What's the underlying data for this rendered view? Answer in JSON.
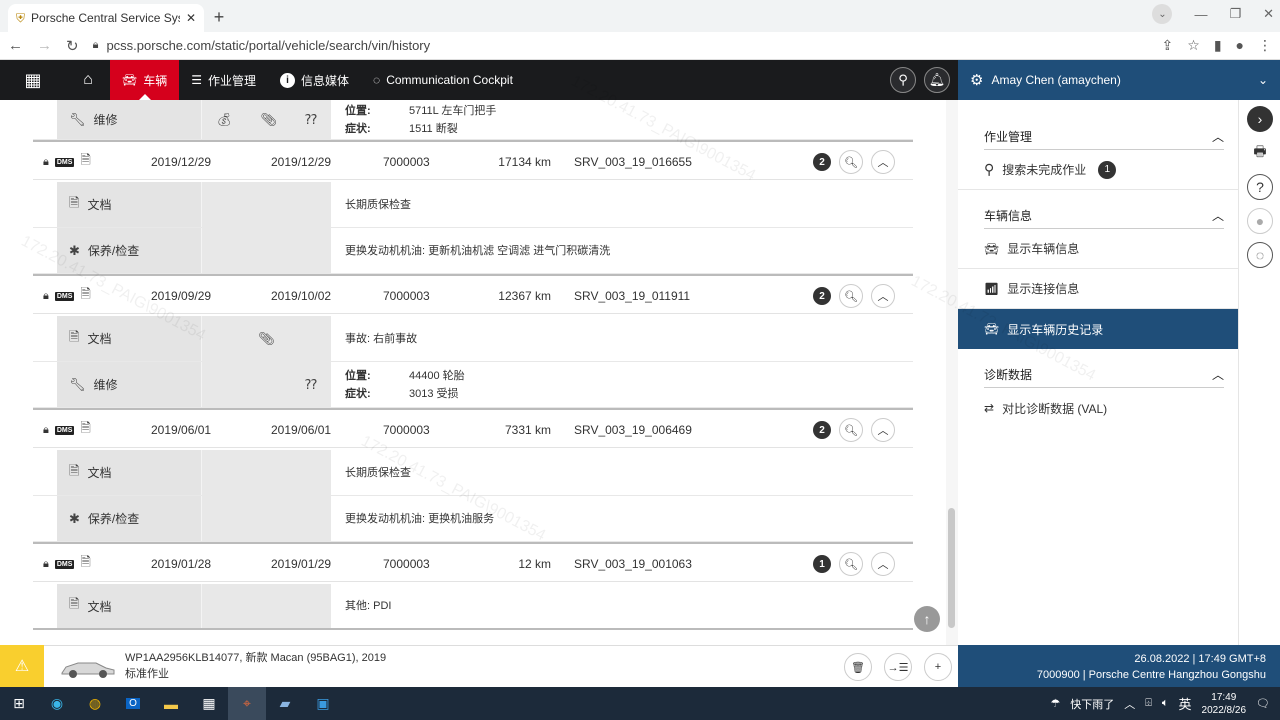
{
  "browser": {
    "tab_title": "Porsche Central Service Syster",
    "url": "pcss.porsche.com/static/portal/vehicle/search/vin/history"
  },
  "nav": {
    "vehicle": "车辆",
    "job_mgmt": "作业管理",
    "info_media": "信息媒体",
    "cockpit": "Communication Cockpit"
  },
  "user": {
    "name": "Amay Chen (amaychen)"
  },
  "top_partial": {
    "label": "维修",
    "pos_label": "位置:",
    "pos_value": "5711L 左车门把手",
    "sym_label": "症状:",
    "sym_value": "1511 断裂"
  },
  "records": [
    {
      "date1": "2019/12/29",
      "date2": "2019/12/29",
      "code": "7000003",
      "km": "17134 km",
      "srv": "SRV_003_19_016655",
      "count": "2",
      "subs": [
        {
          "label": "文档",
          "desc": "长期质保检查"
        },
        {
          "label": "保养/检查",
          "desc": "更换发动机机油: 更新机油机滤 空调滤 进气门积碳清洗"
        }
      ]
    },
    {
      "date1": "2019/09/29",
      "date2": "2019/10/02",
      "code": "7000003",
      "km": "12367 km",
      "srv": "SRV_003_19_011911",
      "count": "2",
      "subs": [
        {
          "label": "文档",
          "desc": "事故: 右前事故"
        },
        {
          "label": "维修",
          "pos_label": "位置:",
          "pos_value": "44400 轮胎",
          "sym_label": "症状:",
          "sym_value": "3013 受损"
        }
      ]
    },
    {
      "date1": "2019/06/01",
      "date2": "2019/06/01",
      "code": "7000003",
      "km": "7331 km",
      "srv": "SRV_003_19_006469",
      "count": "2",
      "subs": [
        {
          "label": "文档",
          "desc": "长期质保检查"
        },
        {
          "label": "保养/检查",
          "desc": "更换发动机机油: 更换机油服务"
        }
      ]
    },
    {
      "date1": "2019/01/28",
      "date2": "2019/01/29",
      "code": "7000003",
      "km": "12 km",
      "srv": "SRV_003_19_001063",
      "count": "1",
      "subs": [
        {
          "label": "文档",
          "desc": "其他: PDI"
        }
      ]
    }
  ],
  "panel": {
    "job_section": "作业管理",
    "search_unfinished": "搜索未完成作业",
    "search_count": "1",
    "vehicle_section": "车辆信息",
    "show_vehicle": "显示车辆信息",
    "show_connect": "显示连接信息",
    "show_history": "显示车辆历史记录",
    "diag_section": "诊断数据",
    "compare_diag": "对比诊断数据 (VAL)"
  },
  "footer": {
    "vin_line": "WP1AA2956KLB14077, 新款 Macan (95BAG1), 2019",
    "job_type": "标准作业",
    "datetime": "26.08.2022 | 17:49 GMT+8",
    "dealer": "7000900 | Porsche Centre Hangzhou Gongshu"
  },
  "taskbar": {
    "weather": "快下雨了",
    "ime": "英",
    "time": "17:49",
    "date": "2022/8/26"
  },
  "watermark": "172.20.41.73_PAIG\\9001354"
}
